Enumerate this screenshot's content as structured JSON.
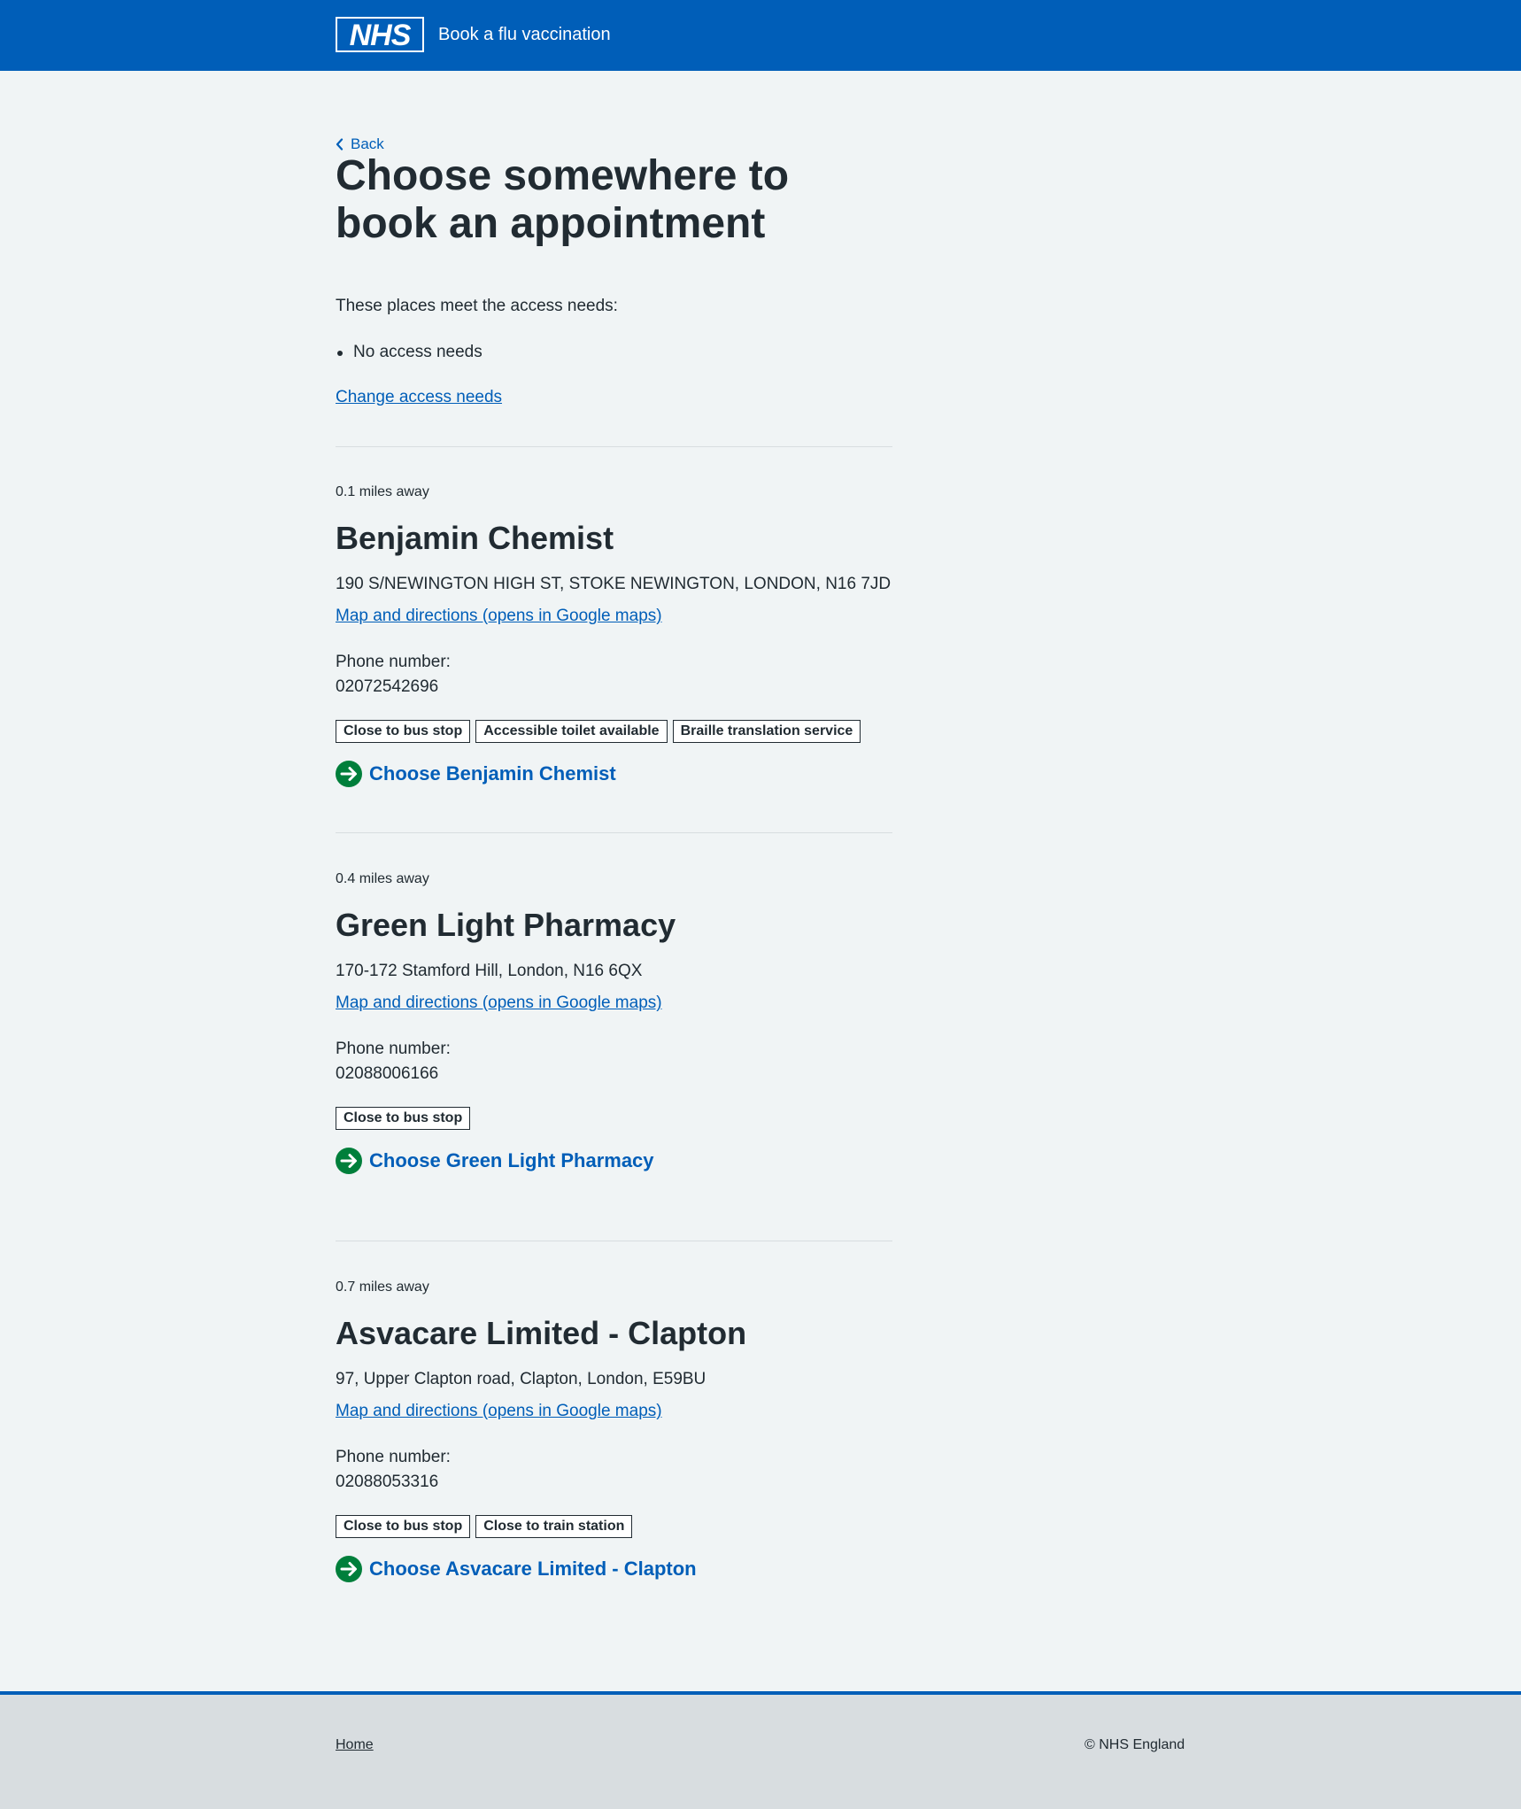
{
  "header": {
    "logo_text": "NHS",
    "service_name": "Book a flu vaccination",
    "brand_color": "#005eb8"
  },
  "nav": {
    "back_label": "Back"
  },
  "page": {
    "title": "Choose somewhere to book an appointment",
    "intro": "These places meet the access needs:",
    "access_needs": [
      "No access needs"
    ],
    "change_link": "Change access needs"
  },
  "locations": [
    {
      "distance": "0.1 miles away",
      "name": "Benjamin Chemist",
      "address": "190 S/NEWINGTON HIGH ST, STOKE NEWINGTON, LONDON, N16 7JD",
      "map_link": "Map and directions (opens in Google maps)",
      "phone_label": "Phone number:",
      "phone": "02072542696",
      "tags": [
        "Close to bus stop",
        "Accessible toilet available",
        "Braille translation service"
      ],
      "action": "Choose Benjamin Chemist"
    },
    {
      "distance": "0.4 miles away",
      "name": "Green Light Pharmacy",
      "address": "170-172 Stamford Hill, London, N16 6QX",
      "map_link": "Map and directions (opens in Google maps)",
      "phone_label": "Phone number:",
      "phone": "02088006166",
      "tags": [
        "Close to bus stop"
      ],
      "action": "Choose Green Light Pharmacy"
    },
    {
      "distance": "0.7 miles away",
      "name": "Asvacare Limited - Clapton",
      "address": "97, Upper Clapton road, Clapton, London, E59BU",
      "map_link": "Map and directions (opens in Google maps)",
      "phone_label": "Phone number:",
      "phone": "02088053316",
      "tags": [
        "Close to bus stop",
        "Close to train station"
      ],
      "action": "Choose Asvacare Limited - Clapton"
    }
  ],
  "footer": {
    "home_link": "Home",
    "copyright": "© NHS England"
  },
  "colors": {
    "link": "#005eb8",
    "action_arrow": "#007f3b",
    "text": "#212b32",
    "background": "#f0f4f5",
    "footer": "#d8dde0"
  }
}
